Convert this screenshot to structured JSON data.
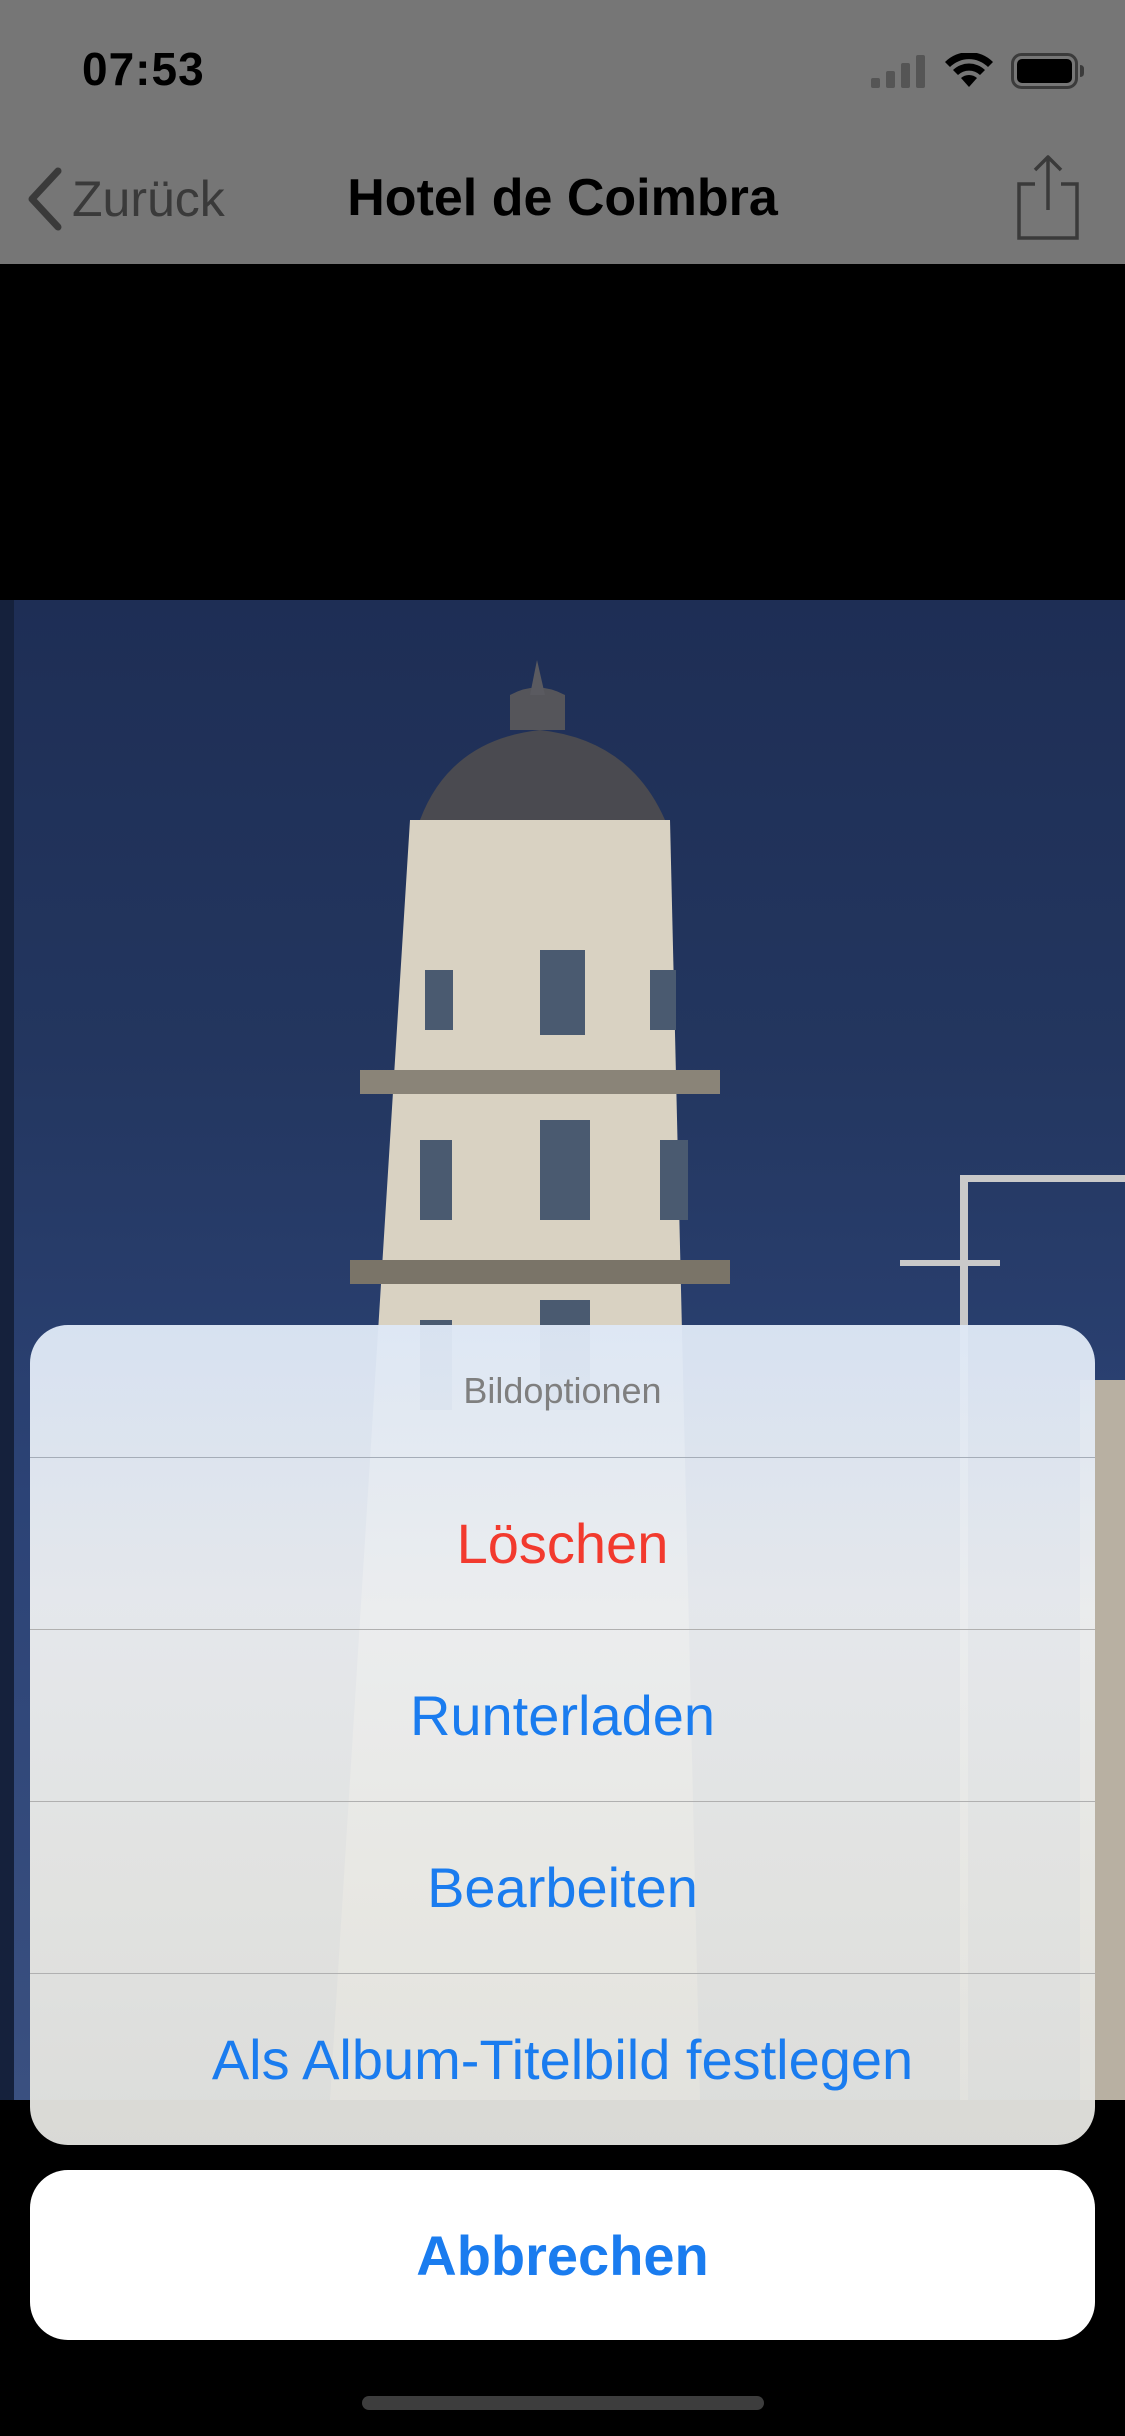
{
  "status_bar": {
    "time": "07:53"
  },
  "nav": {
    "back_label": "Zurück",
    "title": "Hotel de Coimbra"
  },
  "action_sheet": {
    "title": "Bildoptionen",
    "actions": [
      {
        "label": "Löschen",
        "style": "destructive"
      },
      {
        "label": "Runterladen",
        "style": "default"
      },
      {
        "label": "Bearbeiten",
        "style": "default"
      },
      {
        "label": "Als Album-Titelbild festlegen",
        "style": "default"
      }
    ],
    "cancel_label": "Abbrechen"
  },
  "colors": {
    "accent": "#1a7cef",
    "destructive": "#f23a2e"
  }
}
